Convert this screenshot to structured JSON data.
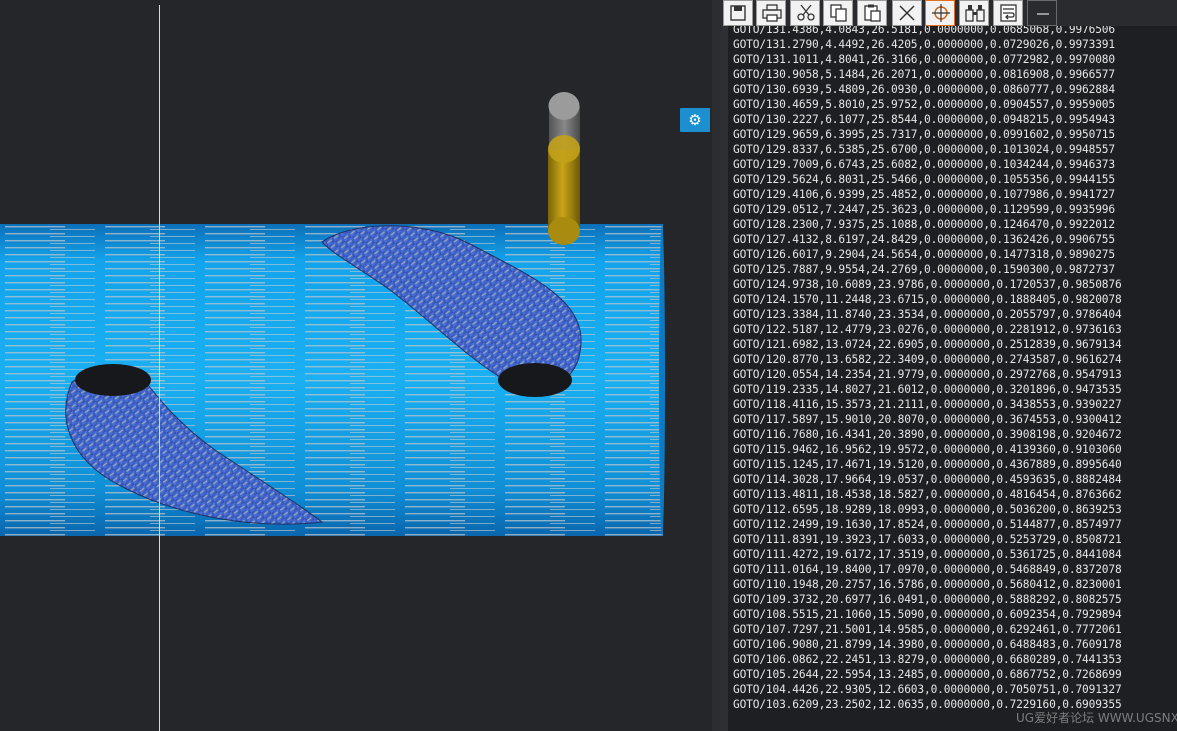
{
  "viewport": {
    "colors": {
      "background": "#25262a",
      "stock": "#1aa7e8",
      "machined": "#3e5fc4",
      "tool": "#b8960f",
      "holder": "#9a9a9a"
    }
  },
  "settings_button": {
    "icon": "gear-icon"
  },
  "toolbar": {
    "buttons": [
      {
        "icon": "save-icon"
      },
      {
        "icon": "print-icon"
      },
      {
        "icon": "scissors-icon"
      },
      {
        "icon": "copy-icon"
      },
      {
        "icon": "paste-icon"
      },
      {
        "icon": "close-icon"
      },
      {
        "icon": "target-icon"
      },
      {
        "icon": "binoculars-icon"
      },
      {
        "icon": "wrap-icon"
      },
      {
        "icon": "minimize-icon"
      }
    ]
  },
  "code_panel": {
    "lines": [
      "GOTO/131.4386,4.0843,26.5181,0.0000000,0.0685068,0.9976506",
      "GOTO/131.2790,4.4492,26.4205,0.0000000,0.0729026,0.9973391",
      "GOTO/131.1011,4.8041,26.3166,0.0000000,0.0772982,0.9970080",
      "GOTO/130.9058,5.1484,26.2071,0.0000000,0.0816908,0.9966577",
      "GOTO/130.6939,5.4809,26.0930,0.0000000,0.0860777,0.9962884",
      "GOTO/130.4659,5.8010,25.9752,0.0000000,0.0904557,0.9959005",
      "GOTO/130.2227,6.1077,25.8544,0.0000000,0.0948215,0.9954943",
      "GOTO/129.9659,6.3995,25.7317,0.0000000,0.0991602,0.9950715",
      "GOTO/129.8337,6.5385,25.6700,0.0000000,0.1013024,0.9948557",
      "GOTO/129.7009,6.6743,25.6082,0.0000000,0.1034244,0.9946373",
      "GOTO/129.5624,6.8031,25.5466,0.0000000,0.1055356,0.9944155",
      "GOTO/129.4106,6.9399,25.4852,0.0000000,0.1077986,0.9941727",
      "GOTO/129.0512,7.2447,25.3623,0.0000000,0.1129599,0.9935996",
      "GOTO/128.2300,7.9375,25.1088,0.0000000,0.1246470,0.9922012",
      "GOTO/127.4132,8.6197,24.8429,0.0000000,0.1362426,0.9906755",
      "GOTO/126.6017,9.2904,24.5654,0.0000000,0.1477318,0.9890275",
      "GOTO/125.7887,9.9554,24.2769,0.0000000,0.1590300,0.9872737",
      "GOTO/124.9738,10.6089,23.9786,0.0000000,0.1720537,0.9850876",
      "GOTO/124.1570,11.2448,23.6715,0.0000000,0.1888405,0.9820078",
      "GOTO/123.3384,11.8740,23.3534,0.0000000,0.2055797,0.9786404",
      "GOTO/122.5187,12.4779,23.0276,0.0000000,0.2281912,0.9736163",
      "GOTO/121.6982,13.0724,22.6905,0.0000000,0.2512839,0.9679134",
      "GOTO/120.8770,13.6582,22.3409,0.0000000,0.2743587,0.9616274",
      "GOTO/120.0554,14.2354,21.9779,0.0000000,0.2972768,0.9547913",
      "GOTO/119.2335,14.8027,21.6012,0.0000000,0.3201896,0.9473535",
      "GOTO/118.4116,15.3573,21.2111,0.0000000,0.3438553,0.9390227",
      "GOTO/117.5897,15.9010,20.8070,0.0000000,0.3674553,0.9300412",
      "GOTO/116.7680,16.4341,20.3890,0.0000000,0.3908198,0.9204672",
      "GOTO/115.9462,16.9562,19.9572,0.0000000,0.4139360,0.9103060",
      "GOTO/115.1245,17.4671,19.5120,0.0000000,0.4367889,0.8995640",
      "GOTO/114.3028,17.9664,19.0537,0.0000000,0.4593635,0.8882484",
      "GOTO/113.4811,18.4538,18.5827,0.0000000,0.4816454,0.8763662",
      "GOTO/112.6595,18.9289,18.0993,0.0000000,0.5036200,0.8639253",
      "GOTO/112.2499,19.1630,17.8524,0.0000000,0.5144877,0.8574977",
      "GOTO/111.8391,19.3923,17.6033,0.0000000,0.5253729,0.8508721",
      "GOTO/111.4272,19.6172,17.3519,0.0000000,0.5361725,0.8441084",
      "GOTO/111.0164,19.8400,17.0970,0.0000000,0.5468849,0.8372078",
      "GOTO/110.1948,20.2757,16.5786,0.0000000,0.5680412,0.8230001",
      "GOTO/109.3732,20.6977,16.0491,0.0000000,0.5888292,0.8082575",
      "GOTO/108.5515,21.1060,15.5090,0.0000000,0.6092354,0.7929894",
      "GOTO/107.7297,21.5001,14.9585,0.0000000,0.6292461,0.7772061",
      "GOTO/106.9080,21.8799,14.3980,0.0000000,0.6488483,0.7609178",
      "GOTO/106.0862,22.2451,13.8279,0.0000000,0.6680289,0.7441353",
      "GOTO/105.2644,22.5954,13.2485,0.0000000,0.6867752,0.7268699",
      "GOTO/104.4426,22.9305,12.6603,0.0000000,0.7050751,0.7091327",
      "GOTO/103.6209,23.2502,12.0635,0.0000000,0.7229160,0.6909355"
    ]
  },
  "watermark": "UG爱好者论坛 WWW.UGSNX.COM"
}
